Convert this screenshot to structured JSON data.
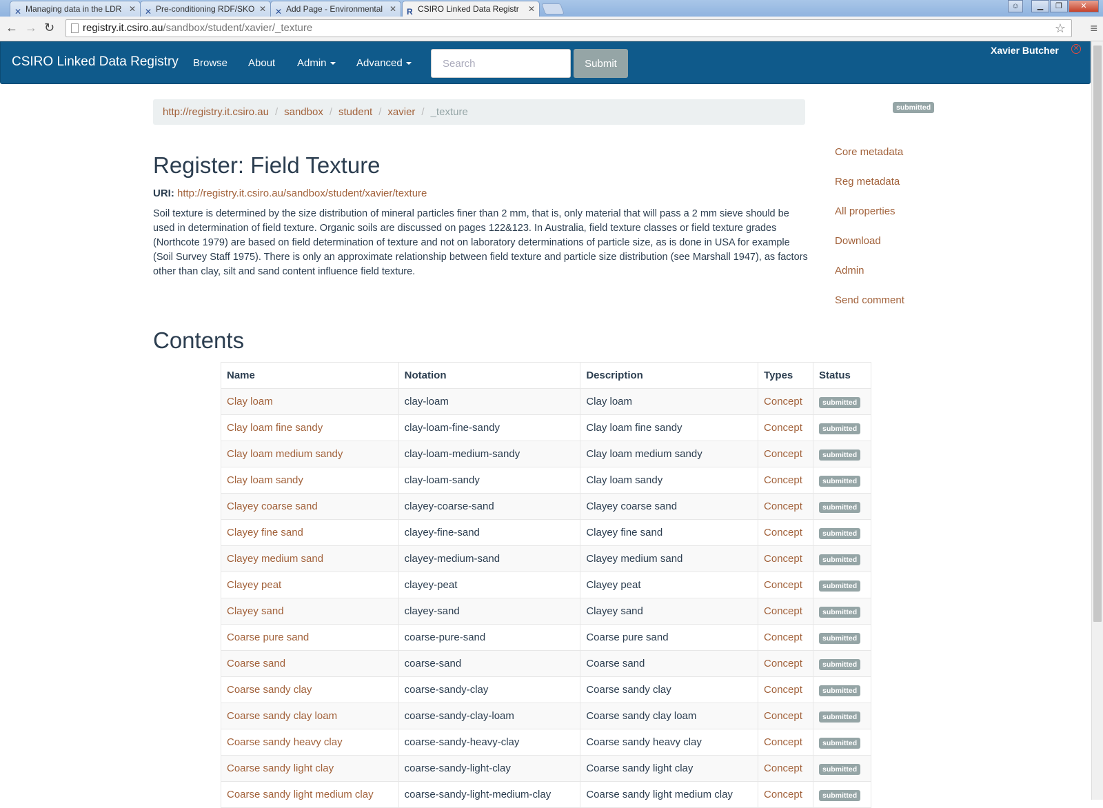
{
  "browser": {
    "tabs": [
      {
        "label": "Managing data in the LDR"
      },
      {
        "label": "Pre-conditioning RDF/SKO"
      },
      {
        "label": "Add Page - Environmental"
      },
      {
        "label": "CSIRO Linked Data Registr"
      }
    ],
    "address_host": "registry.it.csiro.au",
    "address_path": "/sandbox/student/xavier/_texture"
  },
  "navbar": {
    "brand": "CSIRO Linked Data Registry",
    "links": [
      "Browse",
      "About",
      "Admin",
      "Advanced"
    ],
    "search_placeholder": "Search",
    "submit_label": "Submit",
    "user": "Xavier Butcher"
  },
  "breadcrumb": {
    "items": [
      "http://registry.it.csiro.au",
      "sandbox",
      "student",
      "xavier"
    ],
    "current": "_texture"
  },
  "status_badge": "submitted",
  "register": {
    "title": "Register: Field Texture",
    "uri_label": "URI:",
    "uri": "http://registry.it.csiro.au/sandbox/student/xavier/texture",
    "description": "Soil texture is determined by the size distribution of mineral particles finer than 2 mm, that is, only material that will pass a 2 mm sieve should be used in determination of field texture. Organic soils are discussed on pages 122&123. In Australia, field texture classes or field texture grades (Northcote 1979) are based on field determination of texture and not on laboratory determinations of particle size, as is done in USA for example (Soil Survey Staff 1975). There is only an approximate relationship between field texture and particle size distribution (see Marshall 1947), as factors other than clay, silt and sand content influence field texture."
  },
  "sidenav": [
    "Core metadata",
    "Reg metadata",
    "All properties",
    "Download",
    "Admin",
    "Send comment"
  ],
  "contents": {
    "heading": "Contents",
    "columns": [
      "Name",
      "Notation",
      "Description",
      "Types",
      "Status"
    ],
    "rows": [
      {
        "name": "Clay loam",
        "notation": "clay-loam",
        "description": "Clay loam",
        "type": "Concept",
        "status": "submitted"
      },
      {
        "name": "Clay loam fine sandy",
        "notation": "clay-loam-fine-sandy",
        "description": "Clay loam fine sandy",
        "type": "Concept",
        "status": "submitted"
      },
      {
        "name": "Clay loam medium sandy",
        "notation": "clay-loam-medium-sandy",
        "description": "Clay loam medium sandy",
        "type": "Concept",
        "status": "submitted"
      },
      {
        "name": "Clay loam sandy",
        "notation": "clay-loam-sandy",
        "description": "Clay loam sandy",
        "type": "Concept",
        "status": "submitted"
      },
      {
        "name": "Clayey coarse sand",
        "notation": "clayey-coarse-sand",
        "description": "Clayey coarse sand",
        "type": "Concept",
        "status": "submitted"
      },
      {
        "name": "Clayey fine sand",
        "notation": "clayey-fine-sand",
        "description": "Clayey fine sand",
        "type": "Concept",
        "status": "submitted"
      },
      {
        "name": "Clayey medium sand",
        "notation": "clayey-medium-sand",
        "description": "Clayey medium sand",
        "type": "Concept",
        "status": "submitted"
      },
      {
        "name": "Clayey peat",
        "notation": "clayey-peat",
        "description": "Clayey peat",
        "type": "Concept",
        "status": "submitted"
      },
      {
        "name": "Clayey sand",
        "notation": "clayey-sand",
        "description": "Clayey sand",
        "type": "Concept",
        "status": "submitted"
      },
      {
        "name": "Coarse pure sand",
        "notation": "coarse-pure-sand",
        "description": "Coarse pure sand",
        "type": "Concept",
        "status": "submitted"
      },
      {
        "name": "Coarse sand",
        "notation": "coarse-sand",
        "description": "Coarse sand",
        "type": "Concept",
        "status": "submitted"
      },
      {
        "name": "Coarse sandy clay",
        "notation": "coarse-sandy-clay",
        "description": "Coarse sandy clay",
        "type": "Concept",
        "status": "submitted"
      },
      {
        "name": "Coarse sandy clay loam",
        "notation": "coarse-sandy-clay-loam",
        "description": "Coarse sandy clay loam",
        "type": "Concept",
        "status": "submitted"
      },
      {
        "name": "Coarse sandy heavy clay",
        "notation": "coarse-sandy-heavy-clay",
        "description": "Coarse sandy heavy clay",
        "type": "Concept",
        "status": "submitted"
      },
      {
        "name": "Coarse sandy light clay",
        "notation": "coarse-sandy-light-clay",
        "description": "Coarse sandy light clay",
        "type": "Concept",
        "status": "submitted"
      },
      {
        "name": "Coarse sandy light medium clay",
        "notation": "coarse-sandy-light-medium-clay",
        "description": "Coarse sandy light medium clay",
        "type": "Concept",
        "status": "submitted"
      }
    ]
  },
  "colors": {
    "navbar": "#0f5a8b",
    "link": "#a2623b",
    "badge": "#95a5a6"
  }
}
